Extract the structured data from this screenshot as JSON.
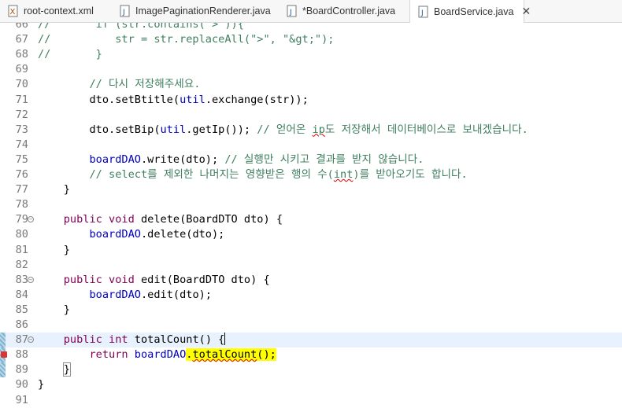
{
  "tabs": [
    {
      "label": "root-context.xml",
      "icon": "xml-file-icon",
      "active": false
    },
    {
      "label": "ImagePaginationRenderer.java",
      "icon": "java-file-icon",
      "active": false
    },
    {
      "label": "*BoardController.java",
      "icon": "java-file-icon",
      "active": false
    },
    {
      "label": "BoardService.java",
      "icon": "java-file-icon",
      "active": true,
      "close": "✕"
    }
  ],
  "lines": [
    {
      "n": "66",
      "text": "//       if (str.contains(\">\")){"
    },
    {
      "n": "67",
      "text": "//          str = str.replaceAll(\">\", \"&gt;\");"
    },
    {
      "n": "68",
      "text": "//       }"
    },
    {
      "n": "69",
      "text": ""
    },
    {
      "n": "70",
      "text": "        // 다시 저장해주세요."
    },
    {
      "n": "71",
      "text": "        dto.setBtitle(util.exchange(str));"
    },
    {
      "n": "72",
      "text": ""
    },
    {
      "n": "73",
      "text": "        dto.setBip(util.getIp()); // 얻어온 ip도 저장해서 데이터베이스로 보내겠습니다."
    },
    {
      "n": "74",
      "text": ""
    },
    {
      "n": "75",
      "text": "        boardDAO.write(dto); // 실행만 시키고 결과를 받지 않습니다."
    },
    {
      "n": "76",
      "text": "        // select를 제외한 나머지는 영향받은 행의 수(int)를 받아오기도 합니다."
    },
    {
      "n": "77",
      "text": "    }"
    },
    {
      "n": "78",
      "text": ""
    },
    {
      "n": "79",
      "text": "    public void delete(BoardDTO dto) {"
    },
    {
      "n": "80",
      "text": "        boardDAO.delete(dto);"
    },
    {
      "n": "81",
      "text": "    }"
    },
    {
      "n": "82",
      "text": ""
    },
    {
      "n": "83",
      "text": "    public void edit(BoardDTO dto) {"
    },
    {
      "n": "84",
      "text": "        boardDAO.edit(dto);"
    },
    {
      "n": "85",
      "text": "    }"
    },
    {
      "n": "86",
      "text": ""
    },
    {
      "n": "87",
      "text": "    public int totalCount() {"
    },
    {
      "n": "88",
      "text": "        return boardDAO.totalCount();"
    },
    {
      "n": "89",
      "text": "    }"
    },
    {
      "n": "90",
      "text": "}"
    },
    {
      "n": "91",
      "text": ""
    }
  ],
  "colors": {
    "comment": "#3f7f5f",
    "keyword": "#7f0055",
    "field": "#0000c0",
    "string": "#2a00ff",
    "current_line": "#e8f2fe",
    "highlight": "#ffff00"
  }
}
